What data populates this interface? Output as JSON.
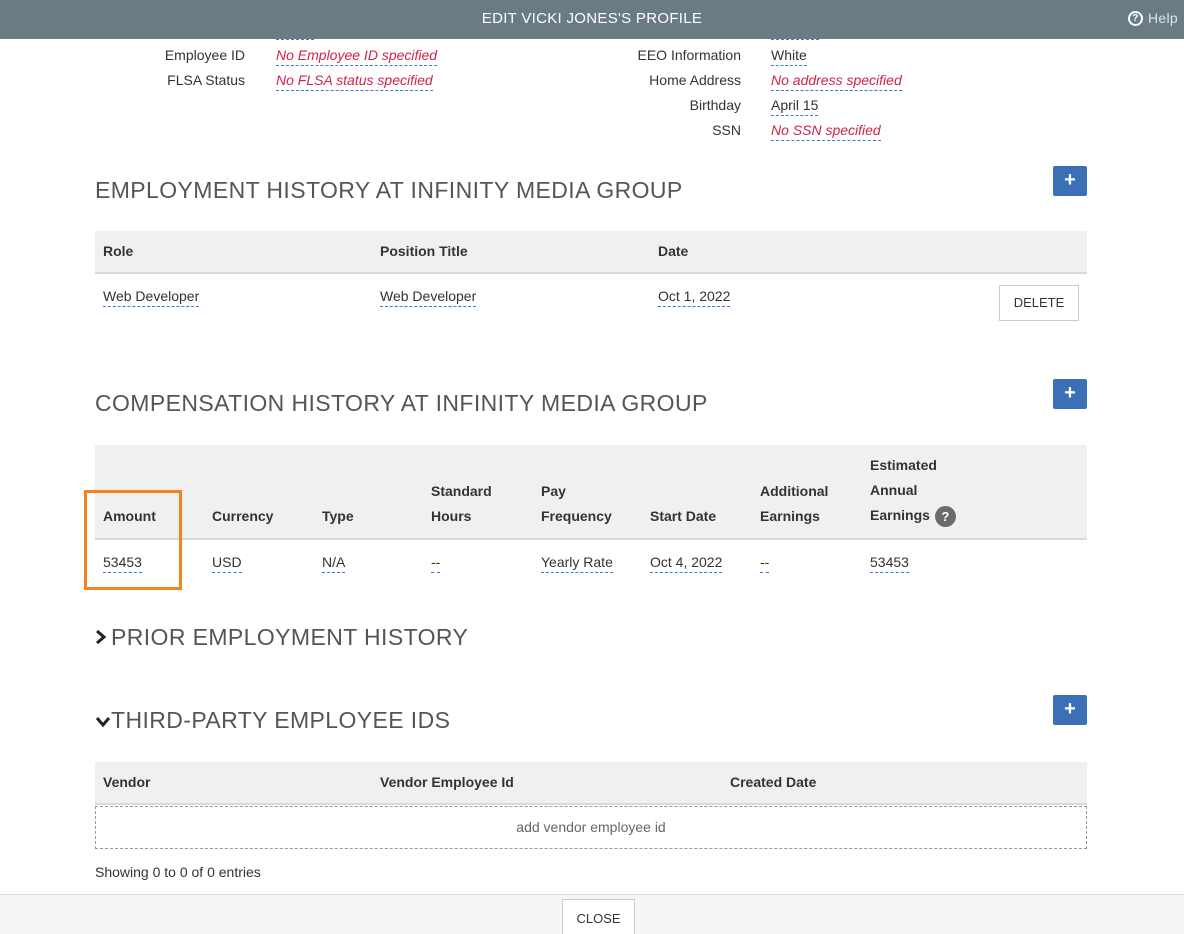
{
  "modal": {
    "title": "EDIT VICKI JONES'S PROFILE",
    "help_label": "Help",
    "close_label": "CLOSE"
  },
  "fields_left": [
    {
      "label": "Employee ID",
      "value": "No Employee ID specified"
    },
    {
      "label": "FLSA Status",
      "value": "No FLSA status specified"
    }
  ],
  "fields_right": [
    {
      "label": "EEO Information",
      "value": "White"
    },
    {
      "label": "Home Address",
      "value": "No address specified"
    },
    {
      "label": "Birthday",
      "value": "April 15"
    },
    {
      "label": "SSN",
      "value": "No SSN specified"
    }
  ],
  "employment": {
    "title": "EMPLOYMENT HISTORY AT INFINITY MEDIA GROUP",
    "headers": [
      "Role",
      "Position Title",
      "Date"
    ],
    "rows": [
      {
        "role": "Web Developer",
        "position": "Web Developer",
        "date": "Oct 1, 2022",
        "delete_label": "DELETE"
      }
    ]
  },
  "compensation": {
    "title": "COMPENSATION HISTORY AT INFINITY MEDIA GROUP",
    "headers": {
      "amount": "Amount",
      "currency": "Currency",
      "type": "Type",
      "standard_hours_1": "Standard",
      "standard_hours_2": "Hours",
      "pay_frequency_1": "Pay",
      "pay_frequency_2": "Frequency",
      "start_date": "Start Date",
      "additional_1": "Additional",
      "additional_2": "Earnings",
      "estimated_1": "Estimated",
      "estimated_2": "Annual",
      "estimated_3": "Earnings"
    },
    "row": {
      "amount": "53453",
      "currency": "USD",
      "type": "N/A",
      "standard_hours": "--",
      "pay_frequency": "Yearly Rate",
      "start_date": "Oct 4, 2022",
      "additional": "--",
      "estimated": "53453"
    }
  },
  "prior": {
    "title": "PRIOR EMPLOYMENT HISTORY"
  },
  "third_party": {
    "title": "THIRD-PARTY EMPLOYEE IDS",
    "headers": [
      "Vendor",
      "Vendor Employee Id",
      "Created Date"
    ],
    "add_label": "add vendor employee id",
    "entries_text": "Showing 0 to 0 of 0 entries"
  },
  "colors": {
    "header_bar": "#6b7b84",
    "accent": "#3b6fb6",
    "empty_value": "#d0234a",
    "highlight": "#f58220"
  }
}
